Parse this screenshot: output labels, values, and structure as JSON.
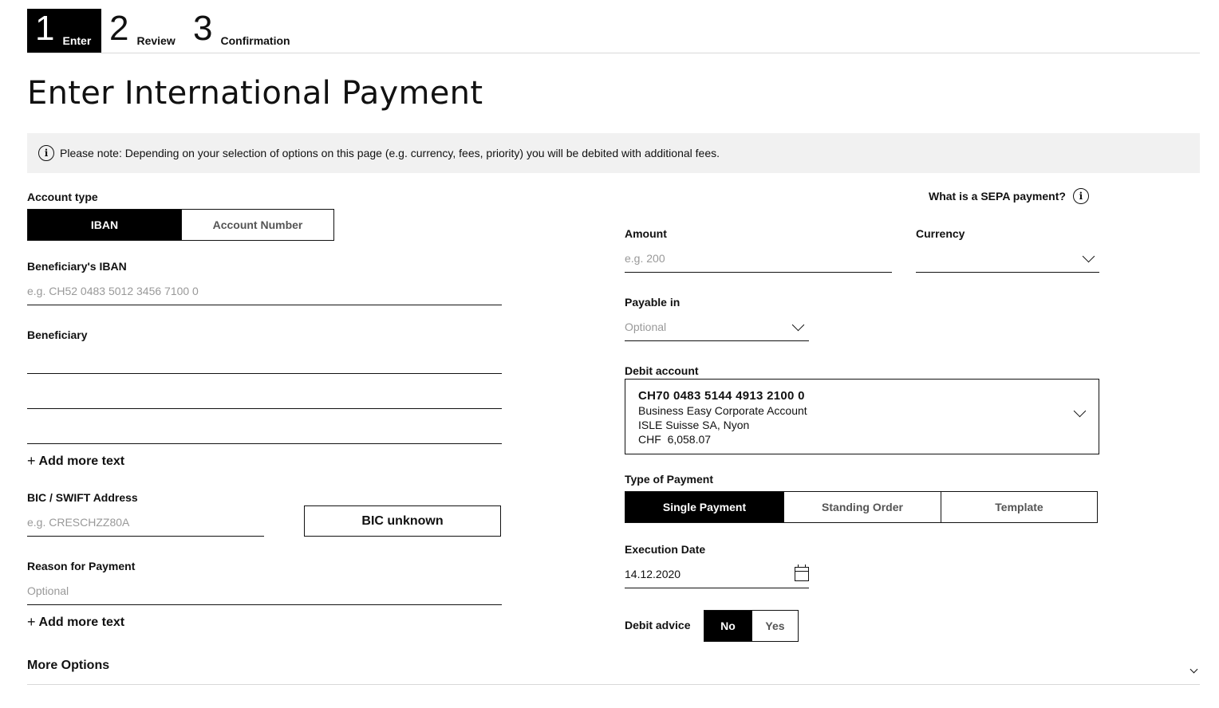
{
  "stepper": {
    "steps": [
      {
        "number": "1",
        "label": "Enter"
      },
      {
        "number": "2",
        "label": "Review"
      },
      {
        "number": "3",
        "label": "Confirmation"
      }
    ],
    "active_step": 1
  },
  "page_title": "Enter International Payment",
  "notice": {
    "icon": "info-icon",
    "text": "Please note: Depending on your selection of options on this page (e.g. currency, fees, priority) you will be debited with additional fees."
  },
  "account_type": {
    "label": "Account type",
    "options": [
      "IBAN",
      "Account Number"
    ],
    "selected": "IBAN"
  },
  "beneficiary_iban": {
    "label": "Beneficiary's IBAN",
    "placeholder": "e.g. CH52 0483 5012 3456 7100 0"
  },
  "beneficiary": {
    "label": "Beneficiary",
    "add_more": "Add more text"
  },
  "bic": {
    "label": "BIC / SWIFT Address",
    "placeholder": "e.g. CRESCHZZ80A",
    "unknown_button": "BIC unknown"
  },
  "reason": {
    "label": "Reason for Payment",
    "placeholder": "Optional",
    "add_more": "Add more text"
  },
  "sepa_link": {
    "text": "What is a SEPA payment?",
    "icon": "info-icon"
  },
  "amount": {
    "label": "Amount",
    "placeholder": "e.g. 200"
  },
  "currency": {
    "label": "Currency",
    "value": ""
  },
  "payable_in": {
    "label": "Payable in",
    "placeholder": "Optional"
  },
  "debit_account": {
    "label": "Debit account",
    "iban": "CH70 0483 5144 4913 2100 0",
    "name": "Business Easy Corporate Account",
    "holder": "ISLE Suisse SA, Nyon",
    "currency": "CHF",
    "balance": "6,058.07"
  },
  "payment_type": {
    "label": "Type of Payment",
    "options": [
      "Single Payment",
      "Standing Order",
      "Template"
    ],
    "selected": "Single Payment"
  },
  "execution_date": {
    "label": "Execution Date",
    "value": "14.12.2020",
    "icon": "calendar-icon"
  },
  "debit_advice": {
    "label": "Debit advice",
    "options": [
      "No",
      "Yes"
    ],
    "selected": "No"
  },
  "more_options": {
    "label": "More Options"
  },
  "colors": {
    "primary": "#000000",
    "notice_bg": "#f1f1f1",
    "placeholder": "#999999"
  }
}
